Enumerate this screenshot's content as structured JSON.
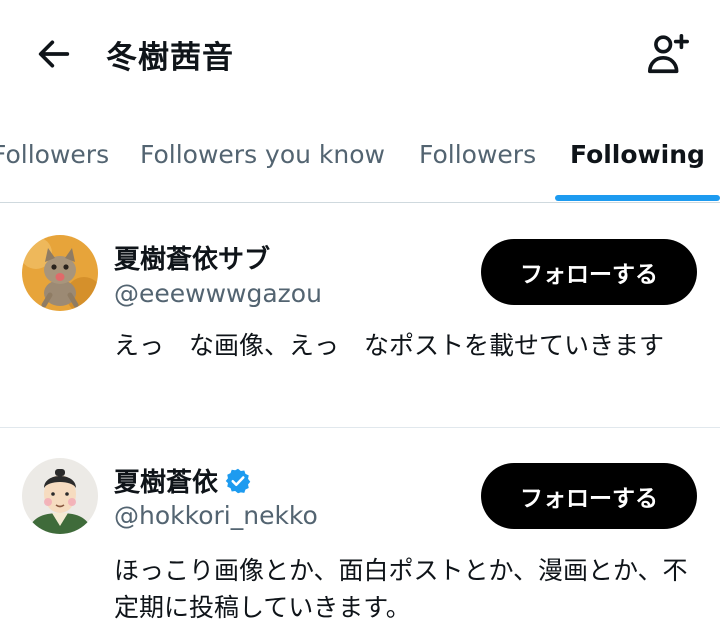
{
  "header": {
    "title": "冬樹茜音",
    "back_icon": "arrow-left-icon",
    "follow_icon": "person-add-icon"
  },
  "tabs": [
    {
      "label": "Followers",
      "active": false
    },
    {
      "label": "Followers you know",
      "active": false
    },
    {
      "label": "Followers",
      "active": false
    },
    {
      "label": "Following",
      "active": true
    }
  ],
  "users": [
    {
      "name": "夏樹蒼依サブ",
      "handle": "@eeewwwgazou",
      "verified": false,
      "button_label": "フォローする",
      "bio": "えっ　な画像、えっ　なポストを載せていきます",
      "avatar": "kitten-photo"
    },
    {
      "name": "夏樹蒼依",
      "handle": "@hokkori_nekko",
      "verified": true,
      "button_label": "フォローする",
      "bio": "ほっこり画像とか、面白ポストとか、漫画とか、不定期に投稿していきます。",
      "avatar": "samurai-illustration"
    }
  ],
  "colors": {
    "accent": "#1d9bf0",
    "secondary_text": "#536471",
    "button_bg": "#000000",
    "verified": "#1d9bf0"
  }
}
